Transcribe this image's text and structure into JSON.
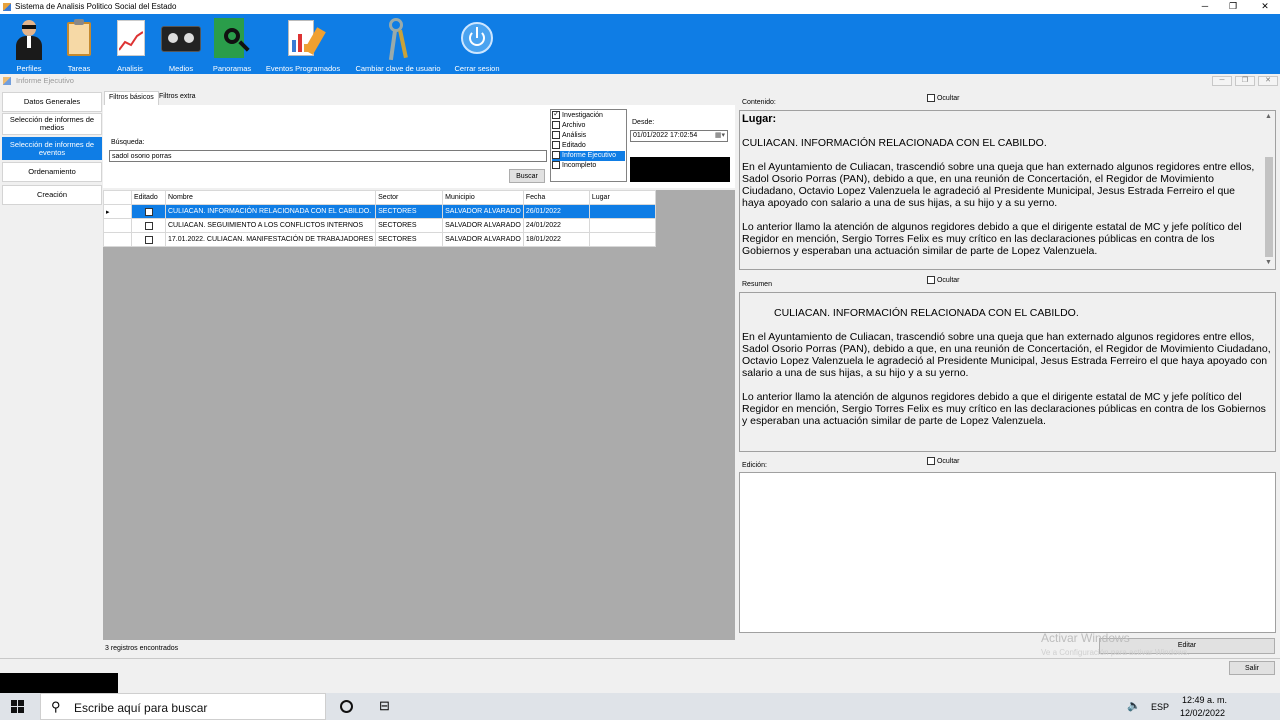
{
  "window": {
    "title": "Sistema de Analisis Politico Social del Estado"
  },
  "ribbon": [
    {
      "label": "Perfiles",
      "icon": "agent-icon"
    },
    {
      "label": "Tareas",
      "icon": "clipboard-icon"
    },
    {
      "label": "Analisis",
      "icon": "chart-icon"
    },
    {
      "label": "Medios",
      "icon": "cassette-icon"
    },
    {
      "label": "Panoramas",
      "icon": "magnifier-icon"
    },
    {
      "label": "Eventos Programados",
      "icon": "report-icon"
    },
    {
      "label": "Cambiar clave de usuario",
      "icon": "keys-icon"
    },
    {
      "label": "Cerrar sesion",
      "icon": "power-icon"
    }
  ],
  "child": {
    "title": "Informe Ejecutivo"
  },
  "nav": [
    "Datos Generales",
    "Selección de informes de medios",
    "Selección de informes de eventos",
    "Ordenamiento",
    "Creación"
  ],
  "tabs": {
    "basic": "Filtros básicos",
    "extra": "Filtros extra"
  },
  "search": {
    "label": "Búsqueda:",
    "value": "sadol osorio porras",
    "button": "Buscar"
  },
  "filters": [
    {
      "label": "Investigación",
      "checked": true
    },
    {
      "label": "Archivo",
      "checked": false
    },
    {
      "label": "Análisis",
      "checked": false
    },
    {
      "label": "Editado",
      "checked": false
    },
    {
      "label": "Informe Ejecutivo",
      "checked": false
    },
    {
      "label": "Incompleto",
      "checked": false
    }
  ],
  "date": {
    "label": "Desde:",
    "value": "01/01/2022 17:02:54"
  },
  "grid": {
    "columns": [
      "Editado",
      "Nombre",
      "Sector",
      "Municipio",
      "Fecha",
      "Lugar"
    ],
    "rows": [
      {
        "nombre": "CULIACAN. INFORMACIÓN RELACIONADA CON EL CABILDO.",
        "sector": "SECTORES",
        "municipio": "SALVADOR ALVARADO",
        "fecha": "26/01/2022",
        "lugar": ""
      },
      {
        "nombre": "CULIACAN. SEGUIMIENTO A LOS CONFLICTOS INTERNOS",
        "sector": "SECTORES",
        "municipio": "SALVADOR ALVARADO",
        "fecha": "24/01/2022",
        "lugar": ""
      },
      {
        "nombre": "17.01.2022. CULIACAN. MANIFESTACIÓN DE TRABAJADORES",
        "sector": "SECTORES",
        "municipio": "SALVADOR ALVARADO",
        "fecha": "18/01/2022",
        "lugar": ""
      }
    ],
    "status": "3 registros encontrados"
  },
  "contenido": {
    "label": "Contenido:",
    "hide": "Ocultar",
    "heading": "Lugar:",
    "title": "CULIACAN. INFORMACIÓN RELACIONADA CON EL CABILDO.",
    "p1": "En el Ayuntamiento de Culiacan, trascendió sobre una queja que han externado algunos regidores entre ellos, Sadol Osorio Porras (PAN), debido a que, en una reunión de Concertación, el Regidor de Movimiento Ciudadano, Octavio Lopez Valenzuela le agradeció al Presidente Municipal, Jesus Estrada Ferreiro el que haya apoyado con salario a una de sus hijas, a su hijo y a su yerno.",
    "p2": "Lo anterior llamo la atención de algunos regidores debido a que el dirigente estatal de MC y jefe político del Regidor en mención, Sergio Torres Felix es muy crítico en las declaraciones públicas en contra de los Gobiernos y esperaban una actuación similar de parte de Lopez Valenzuela."
  },
  "resumen": {
    "label": "Resumen",
    "hide": "Ocultar",
    "title": "CULIACAN. INFORMACIÓN RELACIONADA CON EL CABILDO.",
    "p1": "En el Ayuntamiento de Culiacan, trascendió sobre una queja que han externado algunos regidores entre ellos, Sadol Osorio Porras (PAN), debido a que, en una reunión de Concertación, el Regidor de Movimiento Ciudadano, Octavio Lopez Valenzuela le agradeció al Presidente Municipal, Jesus Estrada Ferreiro el que haya apoyado con salario a una de sus hijas, a su hijo y a su yerno.",
    "p2": "Lo anterior llamo la atención de algunos regidores debido a que el dirigente estatal de MC y jefe político del Regidor en mención, Sergio Torres Felix es muy crítico en las declaraciones públicas en contra de los Gobiernos y esperaban una actuación similar de parte de Lopez Valenzuela."
  },
  "edicion": {
    "label": "Edición:",
    "hide": "Ocultar",
    "button": "Editar"
  },
  "watermark": {
    "line1": "Activar Windows",
    "line2": "Ve a Configuración para activar Windows."
  },
  "salir": "Salir",
  "taskbar": {
    "search": "Escribe aquí para buscar",
    "lang": "ESP",
    "time": "12:49 a. m.",
    "date": "12/02/2022"
  }
}
